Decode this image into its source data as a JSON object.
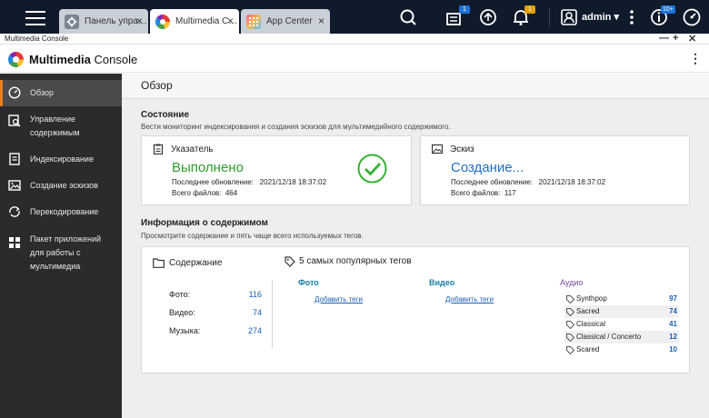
{
  "taskbar": {
    "tabs": [
      {
        "label": "Панель упра…",
        "icon": "gear-icon",
        "active": false
      },
      {
        "label": "Multimedia C…",
        "icon": "multimedia-logo-icon",
        "active": true
      },
      {
        "label": "App Center",
        "icon": "app-center-icon",
        "active": false
      }
    ],
    "close_glyph": "×",
    "notification_badges": {
      "tasks": "1",
      "alerts": "1",
      "dashboard": "10+"
    },
    "user": "admin ▾"
  },
  "window": {
    "title": "Multimedia Console",
    "controls": {
      "minimize": "—",
      "maximize": "+",
      "close": "✕"
    }
  },
  "app": {
    "title_bold": "Multimedia",
    "title_rest": " Console",
    "more_glyph": "⋮"
  },
  "sidebar": {
    "items": [
      {
        "label": "Обзор",
        "icon": "speedometer-icon",
        "active": true
      },
      {
        "label": "Управление содержимым",
        "icon": "content-search-icon",
        "active": false
      },
      {
        "label": "Индексирование",
        "icon": "document-icon",
        "active": false
      },
      {
        "label": "Создание эскизов",
        "icon": "image-icon",
        "active": false
      },
      {
        "label": "Перекодирование",
        "icon": "transcode-icon",
        "active": false
      },
      {
        "label": "Пакет приложений для работы с мультимедиа",
        "icon": "apps-grid-icon",
        "active": false
      }
    ]
  },
  "page": {
    "title": "Обзор",
    "status": {
      "heading": "Состояние",
      "description": "Вести мониторинг индексирования и создания эскизов для мультимедийного содержимого.",
      "indexer": {
        "title": "Указатель",
        "status": "Выполнено",
        "status_color": "#2e9b2e",
        "last_update_label": "Последнее обновление:",
        "last_update": "2021/12/18 18:37:02",
        "files_label": "Всего файлов:",
        "files": "464"
      },
      "thumbnail": {
        "title": "Эскиз",
        "status": "Создание...",
        "status_color": "#1f6fc6",
        "last_update_label": "Последнее обновление:",
        "last_update": "2021/12/18 18:37:02",
        "files_label": "Всего файлов:",
        "files": "117"
      }
    },
    "content_info": {
      "heading": "Информация о содержимом",
      "description": "Просмотрите содержание и пять чаще всего используемых тегов.",
      "contents_title": "Содержание",
      "counts": [
        {
          "label": "Фото:",
          "value": "116"
        },
        {
          "label": "Видео:",
          "value": "74"
        },
        {
          "label": "Музыка:",
          "value": "274"
        }
      ],
      "tags_title": "5 самых популярных тегов",
      "columns": {
        "photo": {
          "title": "Фото",
          "link": "Добавить теги"
        },
        "video": {
          "title": "Видео",
          "link": "Добавить теги"
        },
        "audio": {
          "title": "Аудио"
        }
      },
      "audio_tags": [
        {
          "name": "Synthpop",
          "count": "97"
        },
        {
          "name": "Sacred",
          "count": "74"
        },
        {
          "name": "Classical",
          "count": "41"
        },
        {
          "name": "Classical / Concerto",
          "count": "12"
        },
        {
          "name": "Scared",
          "count": "10"
        }
      ]
    }
  }
}
